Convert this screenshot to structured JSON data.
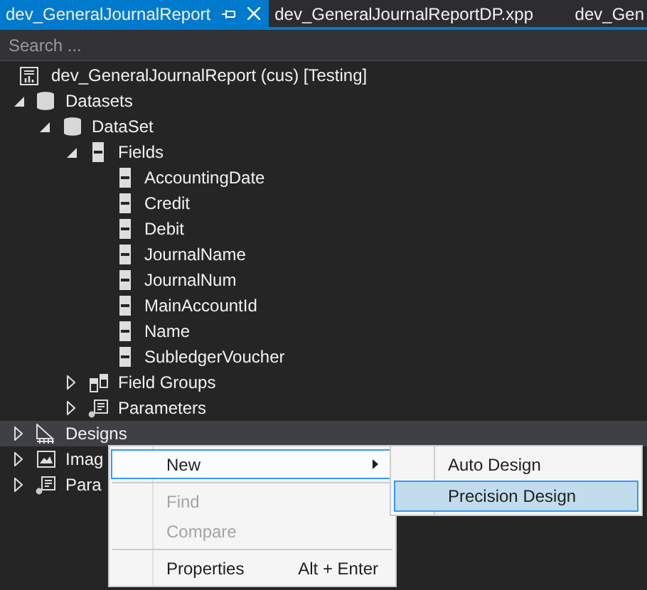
{
  "tabs": [
    {
      "label": "dev_GeneralJournalReport",
      "selected": true
    },
    {
      "label": "dev_GeneralJournalReportDP.xpp",
      "selected": false
    },
    {
      "label": "dev_Gen",
      "selected": false
    }
  ],
  "search": {
    "placeholder": "Search ..."
  },
  "tree": {
    "label": "dev_GeneralJournalReport (cus) [Testing]",
    "kind": "report",
    "selected": false,
    "children": [
      {
        "label": "Datasets",
        "kind": "database",
        "expanded": true,
        "selected": false,
        "children": [
          {
            "label": "DataSet",
            "kind": "database",
            "expanded": true,
            "selected": false,
            "children": [
              {
                "label": "Fields",
                "kind": "field",
                "expanded": true,
                "selected": false,
                "children": [
                  {
                    "label": "AccountingDate",
                    "kind": "field",
                    "selected": false
                  },
                  {
                    "label": "Credit",
                    "kind": "field",
                    "selected": false
                  },
                  {
                    "label": "Debit",
                    "kind": "field",
                    "selected": false
                  },
                  {
                    "label": "JournalName",
                    "kind": "field",
                    "selected": false
                  },
                  {
                    "label": "JournalNum",
                    "kind": "field",
                    "selected": false
                  },
                  {
                    "label": "MainAccountId",
                    "kind": "field",
                    "selected": false
                  },
                  {
                    "label": "Name",
                    "kind": "field",
                    "selected": false
                  },
                  {
                    "label": "SubledgerVoucher",
                    "kind": "field",
                    "selected": false
                  }
                ]
              },
              {
                "label": "Field Groups",
                "kind": "field-group",
                "expanded": false,
                "selected": false
              },
              {
                "label": "Parameters",
                "kind": "parameters",
                "expanded": false,
                "selected": false
              }
            ]
          }
        ]
      },
      {
        "label": "Designs",
        "kind": "design",
        "expanded": false,
        "selected": true
      },
      {
        "label": "Imag",
        "kind": "image",
        "expanded": false,
        "selected": false
      },
      {
        "label": "Para",
        "kind": "parameters",
        "expanded": false,
        "selected": false
      }
    ]
  },
  "context_menu": {
    "items": [
      {
        "kind": "submenu",
        "label": "New",
        "selected": true,
        "disabled": false
      },
      {
        "kind": "separator"
      },
      {
        "kind": "item",
        "label": "Find",
        "selected": false,
        "disabled": true
      },
      {
        "kind": "item",
        "label": "Compare",
        "selected": false,
        "disabled": true
      },
      {
        "kind": "separator"
      },
      {
        "kind": "item",
        "label": "Properties",
        "shortcut": "Alt + Enter",
        "selected": false,
        "disabled": false
      }
    ]
  },
  "submenu": {
    "items": [
      {
        "label": "Auto Design",
        "selected": false
      },
      {
        "label": "Precision Design",
        "selected": true
      }
    ]
  }
}
